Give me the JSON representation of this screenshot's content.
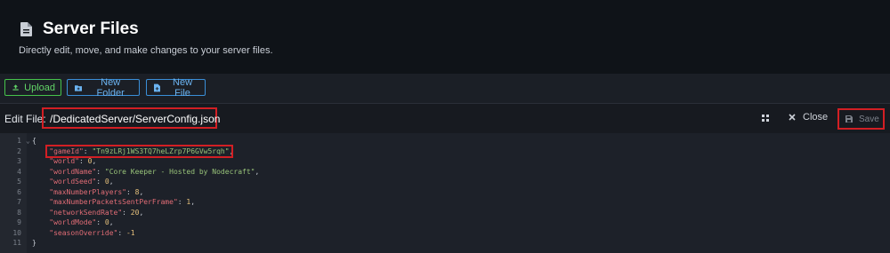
{
  "header": {
    "title": "Server Files",
    "subtitle": "Directly edit, move, and make changes to your server files.",
    "icon": "file-icon"
  },
  "toolbar": {
    "upload_label": "Upload",
    "new_folder_label": "New Folder",
    "new_file_label": "New File"
  },
  "editbar": {
    "label": "Edit File:",
    "path": "/DedicatedServer/ServerConfig.json",
    "close_label": "Close",
    "save_label": "Save"
  },
  "editor": {
    "lines": [
      {
        "n": "1",
        "fold": "⌄",
        "parts": [
          {
            "t": "{",
            "c": "punc"
          }
        ]
      },
      {
        "n": "2",
        "parts": [
          {
            "t": "    \"gameId\"",
            "c": "key"
          },
          {
            "t": ": ",
            "c": "punc"
          },
          {
            "t": "\"Tn9zLRj1WS3TQ7heLZrp7P6GVw5rqh\"",
            "c": "str"
          },
          {
            "t": ",",
            "c": "punc"
          }
        ]
      },
      {
        "n": "3",
        "parts": [
          {
            "t": "    \"world\"",
            "c": "key"
          },
          {
            "t": ": ",
            "c": "punc"
          },
          {
            "t": "0",
            "c": "num"
          },
          {
            "t": ",",
            "c": "punc"
          }
        ]
      },
      {
        "n": "4",
        "parts": [
          {
            "t": "    \"worldName\"",
            "c": "key"
          },
          {
            "t": ": ",
            "c": "punc"
          },
          {
            "t": "\"Core Keeper - Hosted by Nodecraft\"",
            "c": "str"
          },
          {
            "t": ",",
            "c": "punc"
          }
        ]
      },
      {
        "n": "5",
        "parts": [
          {
            "t": "    \"worldSeed\"",
            "c": "key"
          },
          {
            "t": ": ",
            "c": "punc"
          },
          {
            "t": "0",
            "c": "num"
          },
          {
            "t": ",",
            "c": "punc"
          }
        ]
      },
      {
        "n": "6",
        "parts": [
          {
            "t": "    \"maxNumberPlayers\"",
            "c": "key"
          },
          {
            "t": ": ",
            "c": "punc"
          },
          {
            "t": "8",
            "c": "num"
          },
          {
            "t": ",",
            "c": "punc"
          }
        ]
      },
      {
        "n": "7",
        "parts": [
          {
            "t": "    \"maxNumberPacketsSentPerFrame\"",
            "c": "key"
          },
          {
            "t": ": ",
            "c": "punc"
          },
          {
            "t": "1",
            "c": "num"
          },
          {
            "t": ",",
            "c": "punc"
          }
        ]
      },
      {
        "n": "8",
        "parts": [
          {
            "t": "    \"networkSendRate\"",
            "c": "key"
          },
          {
            "t": ": ",
            "c": "punc"
          },
          {
            "t": "20",
            "c": "num"
          },
          {
            "t": ",",
            "c": "punc"
          }
        ]
      },
      {
        "n": "9",
        "parts": [
          {
            "t": "    \"worldMode\"",
            "c": "key"
          },
          {
            "t": ": ",
            "c": "punc"
          },
          {
            "t": "0",
            "c": "num"
          },
          {
            "t": ",",
            "c": "punc"
          }
        ]
      },
      {
        "n": "10",
        "parts": [
          {
            "t": "    \"seasonOverride\"",
            "c": "key"
          },
          {
            "t": ": ",
            "c": "punc"
          },
          {
            "t": "-1",
            "c": "num"
          }
        ]
      },
      {
        "n": "11",
        "parts": [
          {
            "t": "}",
            "c": "punc"
          }
        ]
      }
    ]
  },
  "colors": {
    "highlight": "#d21f24",
    "upload": "#46c44b",
    "action_blue": "#3a8fd8"
  }
}
